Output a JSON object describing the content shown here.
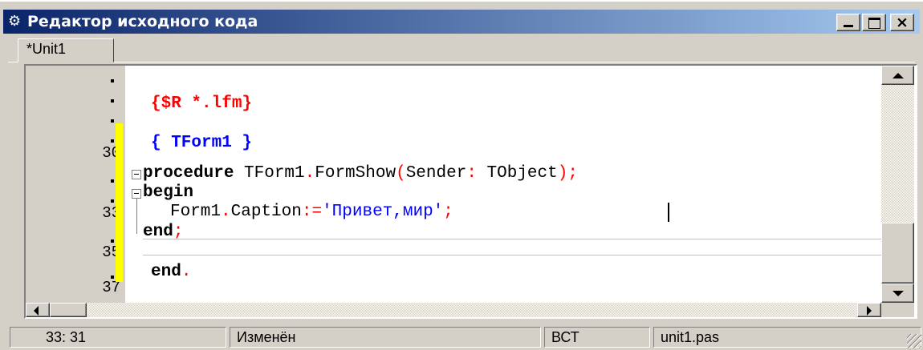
{
  "window": {
    "title": "Редактор исходного кода",
    "icon": "editor-window-icon",
    "minimize_label": "",
    "maximize_label": "",
    "close_label": "×"
  },
  "tabs": [
    {
      "label": "*Unit1",
      "active": true
    }
  ],
  "gutter": {
    "line_numbers": [
      "30",
      "33",
      "35",
      "37"
    ]
  },
  "code": {
    "line1": {
      "text": "{$R *.lfm}"
    },
    "line2": {
      "text": "{ TForm1 }"
    },
    "line3": {
      "kw": "procedure",
      "name": " TForm1",
      "dot": ".",
      "method": "FormShow",
      "paren_open": "(",
      "param": "Sender",
      "colon": ":",
      "type": " TObject",
      "paren_close": ")",
      "semicolon": ";"
    },
    "line4": {
      "kw": "begin"
    },
    "line5": {
      "obj": "Form1",
      "dot": ".",
      "prop": "Caption",
      "assign": ":=",
      "string": "'Привет,мир'",
      "semicolon": ";"
    },
    "line6": {
      "kw": "end",
      "semicolon": ";"
    },
    "line7": {
      "kw": "end",
      "dot": "."
    }
  },
  "status_bar": {
    "position": "33: 31",
    "modified": "Изменён",
    "insert_mode": "ВСТ",
    "filename": "unit1.pas"
  },
  "colors": {
    "directive": "#ff0000",
    "comment": "#0000ff",
    "string": "#0000ff",
    "symbol": "#ff0000",
    "keyword": "#000000",
    "change_marker": "#ffff00",
    "title_bar": "#0a246a"
  }
}
